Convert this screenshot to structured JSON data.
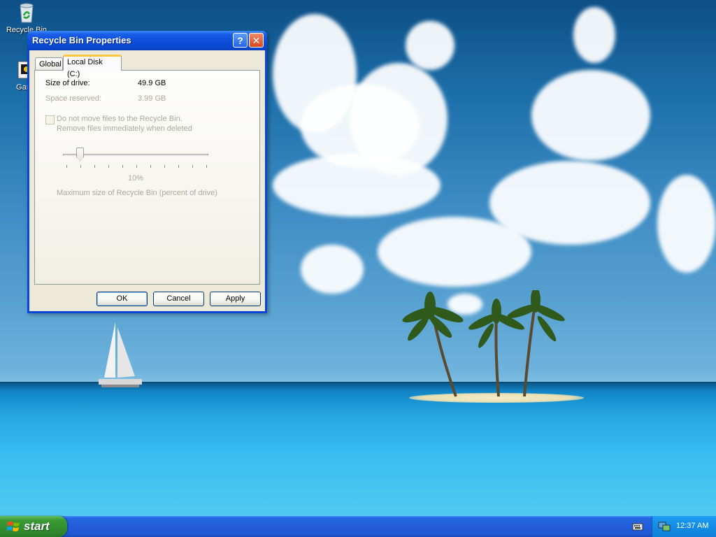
{
  "desktop": {
    "icons": [
      {
        "label": "Recycle Bin",
        "icon": "recycle-bin-icon"
      },
      {
        "label": "Game",
        "icon": "game-icon"
      }
    ]
  },
  "dialog": {
    "title": "Recycle Bin Properties",
    "help_label": "?",
    "close_label": "✕",
    "tabs": [
      {
        "label": "Global",
        "selected": false
      },
      {
        "label": "Local Disk (C:)",
        "selected": true
      }
    ],
    "size_label": "Size of drive:",
    "size_value": "49.9 GB",
    "reserved_label": "Space reserved:",
    "reserved_value": "3.99 GB",
    "checkbox_line1": "Do not move files to the Recycle Bin.",
    "checkbox_line2": "Remove files immediately when deleted",
    "checkbox_checked": false,
    "slider_value_label": "10%",
    "slider_value_fraction": 0.1,
    "slider_caption": "Maximum size of Recycle Bin (percent of drive)",
    "buttons": {
      "ok": "OK",
      "cancel": "Cancel",
      "apply": "Apply"
    }
  },
  "taskbar": {
    "start_label": "start",
    "clock": "12:37 AM",
    "tray_icons": [
      "keyboard-icon",
      "network-icon"
    ]
  },
  "colors": {
    "titlebar": "#0a46d8",
    "dialog_face": "#ece9d8",
    "disabled_text": "#aca899",
    "taskbar": "#245ddb",
    "start_button": "#3a9a36",
    "tray": "#138ce6"
  }
}
